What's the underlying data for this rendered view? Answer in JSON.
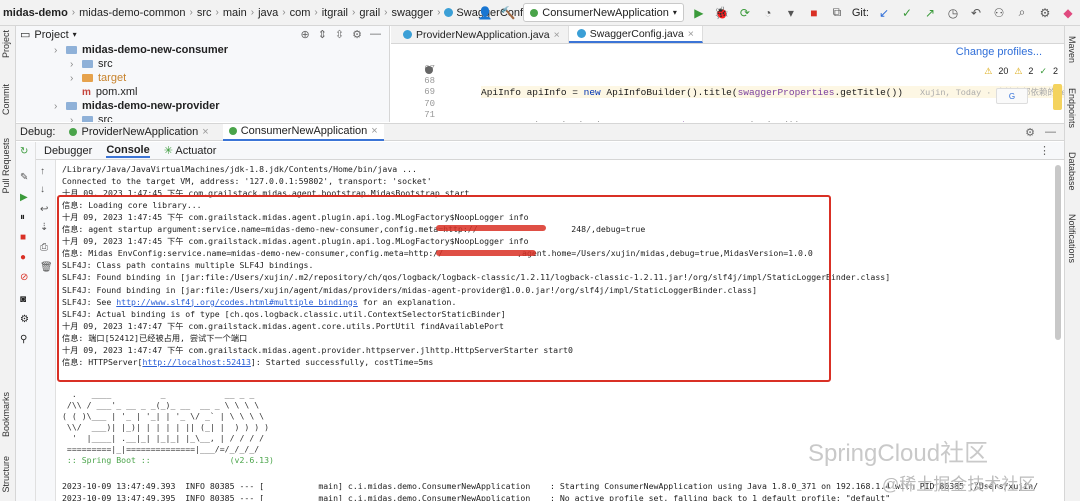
{
  "topbar": {
    "crumbs": [
      "midas-demo",
      "midas-demo-common",
      "src",
      "main",
      "java",
      "com",
      "itgrail",
      "grail",
      "swagger",
      "SwaggerConfig"
    ],
    "run_config": "ConsumerNewApplication",
    "git_label": "Git:"
  },
  "left_strip": [
    "Project",
    "Commit",
    "Pull Requests",
    "Bookmarks",
    "Structure"
  ],
  "right_strip": [
    "Maven",
    "Endpoints",
    "Database",
    "Notifications"
  ],
  "project": {
    "header": "Project",
    "tree": [
      {
        "label": "midas-demo-new-consumer",
        "bold": true,
        "indent": 38,
        "icon": "folder"
      },
      {
        "label": "src",
        "indent": 54,
        "icon": "folder"
      },
      {
        "label": "target",
        "indent": 54,
        "icon": "folder-orange",
        "color": "#c7822b"
      },
      {
        "label": "pom.xml",
        "indent": 54,
        "icon": "maven"
      },
      {
        "label": "midas-demo-new-provider",
        "bold": true,
        "indent": 38,
        "icon": "folder"
      },
      {
        "label": "src",
        "indent": 54,
        "icon": "folder"
      }
    ]
  },
  "editor": {
    "tabs": [
      "ProviderNewApplication.java",
      "SwaggerConfig.java"
    ],
    "change_profiles": "Change profiles...",
    "line_numbers": [
      "67",
      "68",
      "69",
      "70",
      "71"
    ],
    "inlay": "Xujin, Today · 去掉内部依赖的demo",
    "inspections": [
      "20",
      "2",
      "2"
    ]
  },
  "debug": {
    "label": "Debug:",
    "tabs": [
      "ProviderNewApplication",
      "ConsumerNewApplication"
    ],
    "subtabs": [
      "Debugger",
      "Console",
      "Actuator"
    ]
  },
  "console": {
    "lines": [
      "/Library/Java/JavaVirtualMachines/jdk-1.8.jdk/Contents/Home/bin/java ...",
      "Connected to the target VM, address: '127.0.0.1:59802', transport: 'socket'",
      "十月 09, 2023 1:47:45 下午 com.grailstack.midas.agent.bootstrap.MidasBootstrap start",
      "信息: Loading core library...",
      "十月 09, 2023 1:47:45 下午 com.grailstack.midas.agent.plugin.api.log.MLogFactory$NoopLogger info",
      "信息: agent startup argument:service.name=midas-demo-new-consumer,config.meta=http://                   248/,debug=true",
      "十月 09, 2023 1:47:45 下午 com.grailstack.midas.agent.plugin.api.log.MLogFactory$NoopLogger info",
      "信息: Midas EnvConfig:service.name=midas-demo-new-consumer,config.meta=http://               ,agent.home=/Users/xujin/midas,debug=true,MidasVersion=1.0.0",
      "SLF4J: Class path contains multiple SLF4J bindings.",
      "SLF4J: Found binding in [jar:file:/Users/xujin/.m2/repository/ch/qos/logback/logback-classic/1.2.11/logback-classic-1.2.11.jar!/org/slf4j/impl/StaticLoggerBinder.class]",
      "SLF4J: Found binding in [jar:file:/Users/xujin/agent/midas/providers/midas-agent-provider@1.0.0.jar!/org/slf4j/impl/StaticLoggerBinder.class]",
      "SLF4J: See http://www.slf4j.org/codes.html#multiple_bindings for an explanation.",
      "SLF4J: Actual binding is of type [ch.qos.logback.classic.util.ContextSelectorStaticBinder]",
      "十月 09, 2023 1:47:47 下午 com.grailstack.midas.agent.core.utils.PortUtil findAvailablePort",
      "信息: 端口[52412]已经被占用, 尝试下一个端口",
      "十月 09, 2023 1:47:47 下午 com.grailstack.midas.agent.provider.httpserver.jlhttp.HttpServerStarter start0",
      "信息: HTTPServer[http://localhost:52413]: Started successfully, costTime=5ms"
    ],
    "banner": [
      "  .   ____          _            __ _ _",
      " /\\\\ / ___'_ __ _ _(_)_ __  __ _ \\ \\ \\ \\",
      "( ( )\\___ | '_ | '_| | '_ \\/ _` | \\ \\ \\ \\",
      " \\\\/  ___)| |_)| | | | | || (_| |  ) ) ) )",
      "  '  |____| .__|_| |_|_| |_\\__, | / / / /",
      " =========|_|==============|___/=/_/_/_/",
      " :: Spring Boot ::                (v2.6.13)"
    ],
    "log_lines": [
      "2023-10-09 13:47:49.393  INFO 80385 --- [           main] c.i.midas.demo.ConsumerNewApplication    : Starting ConsumerNewApplication using Java 1.8.0_371 on 192.168.1.4 with PID 80385 (/Users/xujin/",
      "2023-10-09 13:47:49.395  INFO 80385 --- [           main] c.i.midas.demo.ConsumerNewApplication    : No active profile set, falling back to 1 default profile: \"default\""
    ]
  },
  "watermarks": [
    "SpringCloud社区",
    "@稀土掘金技术社区"
  ],
  "colors": {
    "accent": "#3b74d6",
    "highlight_box": "#d93025",
    "link": "#2a5fd6"
  }
}
